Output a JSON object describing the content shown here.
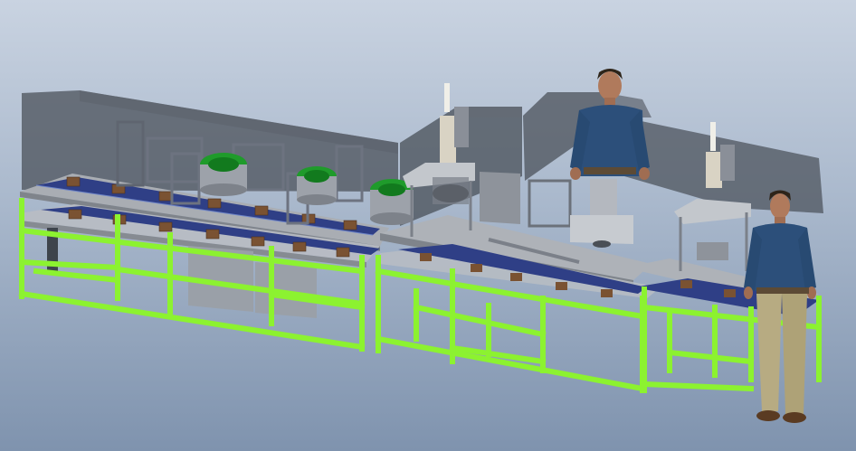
{
  "viewport": {
    "background_top": "#c9d3e1",
    "background_bottom": "#7f93ae"
  },
  "colors": {
    "frame": "#8cf230",
    "frame_shadow": "#5fb41c",
    "enclosure": "#4f565f",
    "plate": "#a9adb3",
    "conveyor_belt": "#2f3f86",
    "pallet": "#7a5232",
    "bowl": "#1f9b2b",
    "press": "#d9d3c4",
    "shirt": "#2c4f7a",
    "pants": "#b7ab82",
    "skin": "#b07a5c"
  },
  "scene": {
    "type": "3D CAD assembly line render",
    "figures": 2,
    "vibratory_bowls": 3,
    "press_units": 2
  }
}
